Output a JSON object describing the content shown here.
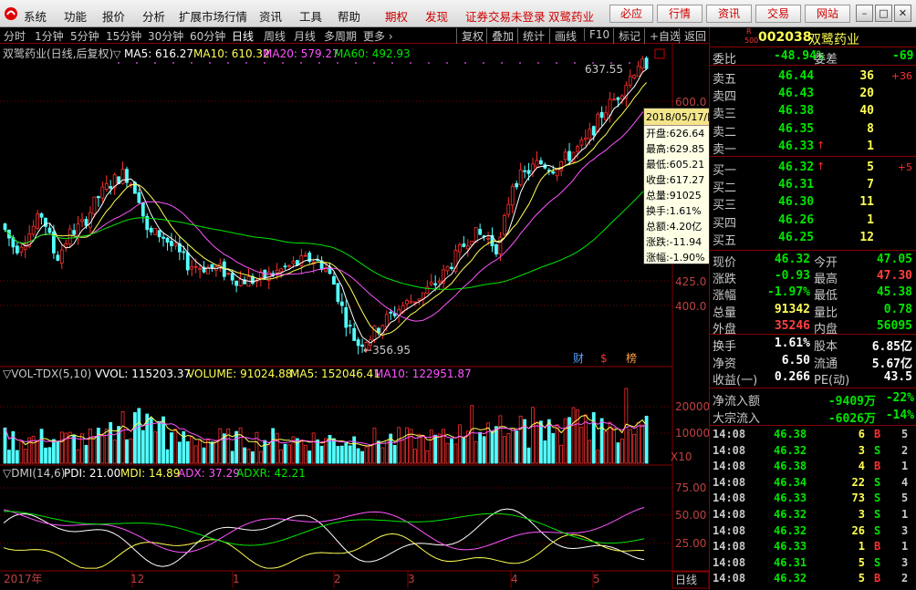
{
  "menubar": {
    "items": [
      "系统",
      "功能",
      "报价",
      "分析",
      "扩展市场行情",
      "资讯",
      "工具",
      "帮助"
    ],
    "period": "期权",
    "faxian": "发现",
    "status": "证券交易未登录",
    "stock_title": "双鹭药业",
    "quick": [
      "必应",
      "行情",
      "资讯",
      "交易",
      "网站"
    ]
  },
  "toolbar": {
    "periods": [
      "分时",
      "1分钟",
      "5分钟",
      "15分钟",
      "30分钟",
      "60分钟",
      "日线",
      "周线",
      "月线",
      "多周期",
      "更多"
    ],
    "active": "日线",
    "actions": [
      "复权",
      "叠加",
      "统计",
      "画线",
      "F10",
      "标记",
      "+自选",
      "返回"
    ]
  },
  "main": {
    "title": "双鹭药业(日线,后复权)",
    "ma": [
      {
        "label": "MA5: 616.27",
        "color": "#ffffff"
      },
      {
        "label": "MA10: 610.32",
        "color": "#ffff54"
      },
      {
        "label": "MA20: 579.27",
        "color": "#ff54ff"
      },
      {
        "label": "MA60: 492.93",
        "color": "#00e600"
      }
    ],
    "price_axis": [
      "600.0",
      "425.0",
      "400.0"
    ],
    "high_label": "637.55",
    "low_label": "356.95",
    "markers": [
      "财",
      "$",
      "榜"
    ]
  },
  "tooltip": {
    "date": "2018/05/17/四",
    "rows": [
      "开盘:626.64",
      "最高:629.85",
      "最低:605.21",
      "收盘:617.27",
      "总量:91025",
      "换手:1.61%",
      "总额:4.20亿",
      "涨跌:-11.94",
      "涨幅:-1.90%"
    ]
  },
  "volume": {
    "title": "VOL-TDX(5,10)",
    "values": [
      {
        "label": "VVOL: 115203.37",
        "color": "#ffffff"
      },
      {
        "label": "VOLUME: 91024.88",
        "color": "#ffff54"
      },
      {
        "label": "MA5: 152046.41",
        "color": "#ffff54"
      },
      {
        "label": "MA10: 122951.87",
        "color": "#ff54ff"
      }
    ],
    "axis": [
      "20000",
      "10000"
    ],
    "unit": "X10"
  },
  "dmi": {
    "title": "DMI(14,6)",
    "values": [
      {
        "label": "PDI: 21.00",
        "color": "#ffffff"
      },
      {
        "label": "MDI: 14.89",
        "color": "#ffff54"
      },
      {
        "label": "ADX: 37.29",
        "color": "#ff54ff"
      },
      {
        "label": "ADXR: 42.21",
        "color": "#00e600"
      }
    ],
    "axis": [
      "75.00",
      "50.00",
      "25.00"
    ]
  },
  "xaxis": {
    "labels": [
      "2017年",
      "12",
      "1",
      "2",
      "3",
      "4",
      "5"
    ],
    "period": "日线"
  },
  "panel": {
    "code": "002038",
    "name": "双鹭药业",
    "badge_top": "R",
    "badge_bot": "500",
    "weibi_label": "委比",
    "weibi": "-48.94%",
    "weicha_label": "委差",
    "weicha": "-69",
    "sell": [
      {
        "label": "卖五",
        "price": "46.44",
        "vol": "36",
        "chg": "+36"
      },
      {
        "label": "卖四",
        "price": "46.43",
        "vol": "20",
        "chg": ""
      },
      {
        "label": "卖三",
        "price": "46.38",
        "vol": "40",
        "chg": ""
      },
      {
        "label": "卖二",
        "price": "46.35",
        "vol": "8",
        "chg": ""
      },
      {
        "label": "卖一",
        "price": "46.33",
        "vol": "1",
        "chg": ""
      }
    ],
    "buy": [
      {
        "label": "买一",
        "price": "46.32",
        "vol": "5",
        "chg": "+5"
      },
      {
        "label": "买二",
        "price": "46.31",
        "vol": "7",
        "chg": ""
      },
      {
        "label": "买三",
        "price": "46.30",
        "vol": "11",
        "chg": ""
      },
      {
        "label": "买四",
        "price": "46.26",
        "vol": "1",
        "chg": ""
      },
      {
        "label": "买五",
        "price": "46.25",
        "vol": "12",
        "chg": ""
      }
    ],
    "stats": [
      {
        "l1": "现价",
        "v1": "46.32",
        "c1": "#00e600",
        "l2": "今开",
        "v2": "47.05",
        "c2": "#00e600"
      },
      {
        "l1": "涨跌",
        "v1": "-0.93",
        "c1": "#00e600",
        "l2": "最高",
        "v2": "47.30",
        "c2": "#ff4040"
      },
      {
        "l1": "涨幅",
        "v1": "-1.97%",
        "c1": "#00e600",
        "l2": "最低",
        "v2": "45.38",
        "c2": "#00e600"
      },
      {
        "l1": "总量",
        "v1": "91342",
        "c1": "#ffff54",
        "l2": "量比",
        "v2": "0.78",
        "c2": "#00e600"
      },
      {
        "l1": "外盘",
        "v1": "35246",
        "c1": "#ff4040",
        "l2": "内盘",
        "v2": "56095",
        "c2": "#00e600"
      }
    ],
    "stats2": [
      {
        "l1": "换手",
        "v1": "1.61%",
        "l2": "股本",
        "v2": "6.85亿"
      },
      {
        "l1": "净资",
        "v1": "6.50",
        "l2": "流通",
        "v2": "5.67亿"
      },
      {
        "l1": "收益(一)",
        "v1": "0.266",
        "l2": "PE(动)",
        "v2": "43.5"
      }
    ],
    "flow": [
      {
        "label": "净流入额",
        "value": "-9409万",
        "pct": "-22%"
      },
      {
        "label": "大宗流入",
        "value": "-6026万",
        "pct": "-14%"
      }
    ],
    "ticks": [
      {
        "t": "14:08",
        "p": "46.38",
        "v": "6",
        "bs": "B",
        "n": "5"
      },
      {
        "t": "14:08",
        "p": "46.32",
        "v": "3",
        "bs": "S",
        "n": "2"
      },
      {
        "t": "14:08",
        "p": "46.38",
        "v": "4",
        "bs": "B",
        "n": "1"
      },
      {
        "t": "14:08",
        "p": "46.34",
        "v": "22",
        "bs": "S",
        "n": "4"
      },
      {
        "t": "14:08",
        "p": "46.33",
        "v": "73",
        "bs": "S",
        "n": "5"
      },
      {
        "t": "14:08",
        "p": "46.32",
        "v": "3",
        "bs": "S",
        "n": "1"
      },
      {
        "t": "14:08",
        "p": "46.32",
        "v": "26",
        "bs": "S",
        "n": "3"
      },
      {
        "t": "14:08",
        "p": "46.33",
        "v": "1",
        "bs": "B",
        "n": "1"
      },
      {
        "t": "14:08",
        "p": "46.31",
        "v": "5",
        "bs": "S",
        "n": "3"
      },
      {
        "t": "14:08",
        "p": "46.32",
        "v": "5",
        "bs": "B",
        "n": "2"
      }
    ]
  },
  "colors": {
    "up": "#ff3030",
    "down": "#54ffff",
    "ma5": "#ffffff",
    "ma10": "#ffff54",
    "ma20": "#ff54ff",
    "ma60": "#00e600",
    "grid": "#800000"
  },
  "chart_data": {
    "type": "candlestick",
    "title": "双鹭药业(日线,后复权)",
    "price_ticks": [
      600.0,
      425.0,
      400.0
    ],
    "visible_extremes": {
      "high": 637.55,
      "low": 356.95
    },
    "last_bar": {
      "date": "2018/05/17",
      "open": 626.64,
      "high": 629.85,
      "low": 605.21,
      "close": 617.27,
      "volume": 91025
    },
    "last_ma": {
      "MA5": 616.27,
      "MA10": 610.32,
      "MA20": 579.27,
      "MA60": 492.93
    },
    "volume_ticks": [
      20000,
      10000
    ],
    "dmi_ticks": [
      75,
      50,
      25
    ],
    "last_dmi": {
      "PDI": 21.0,
      "MDI": 14.89,
      "ADX": 37.29,
      "ADXR": 42.21
    }
  }
}
